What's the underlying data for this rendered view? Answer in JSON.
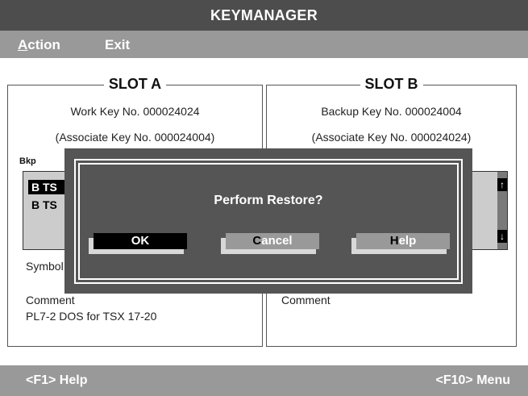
{
  "app": {
    "title": "KEYMANAGER"
  },
  "menu": {
    "action": {
      "hot": "A",
      "rest": "ction"
    },
    "exit": {
      "hot": "E",
      "rest": "xit"
    }
  },
  "slot_a": {
    "title": "SLOT A",
    "key_line": "Work Key No. 000024024",
    "assoc_line": "(Associate Key No. 000024004)",
    "list_label": "Bkp",
    "list_items": [
      "B TS",
      "B TS"
    ],
    "symbol_label": "Symbol",
    "comment_label": "Comment",
    "comment_value": "PL7-2 DOS for TSX 17-20"
  },
  "slot_b": {
    "title": "SLOT B",
    "key_line": "Backup Key No. 000024004",
    "assoc_line": "(Associate Key No. 000024024)",
    "comment_label": "Comment",
    "scroll_up": "↑",
    "scroll_down": "↓"
  },
  "dialog": {
    "message": "Perform Restore?",
    "ok": "OK",
    "cancel": {
      "hot": "C",
      "rest": "ancel"
    },
    "help": {
      "hot": "H",
      "rest": "elp"
    }
  },
  "status": {
    "left": "<F1> Help",
    "right": "<F10> Menu"
  }
}
